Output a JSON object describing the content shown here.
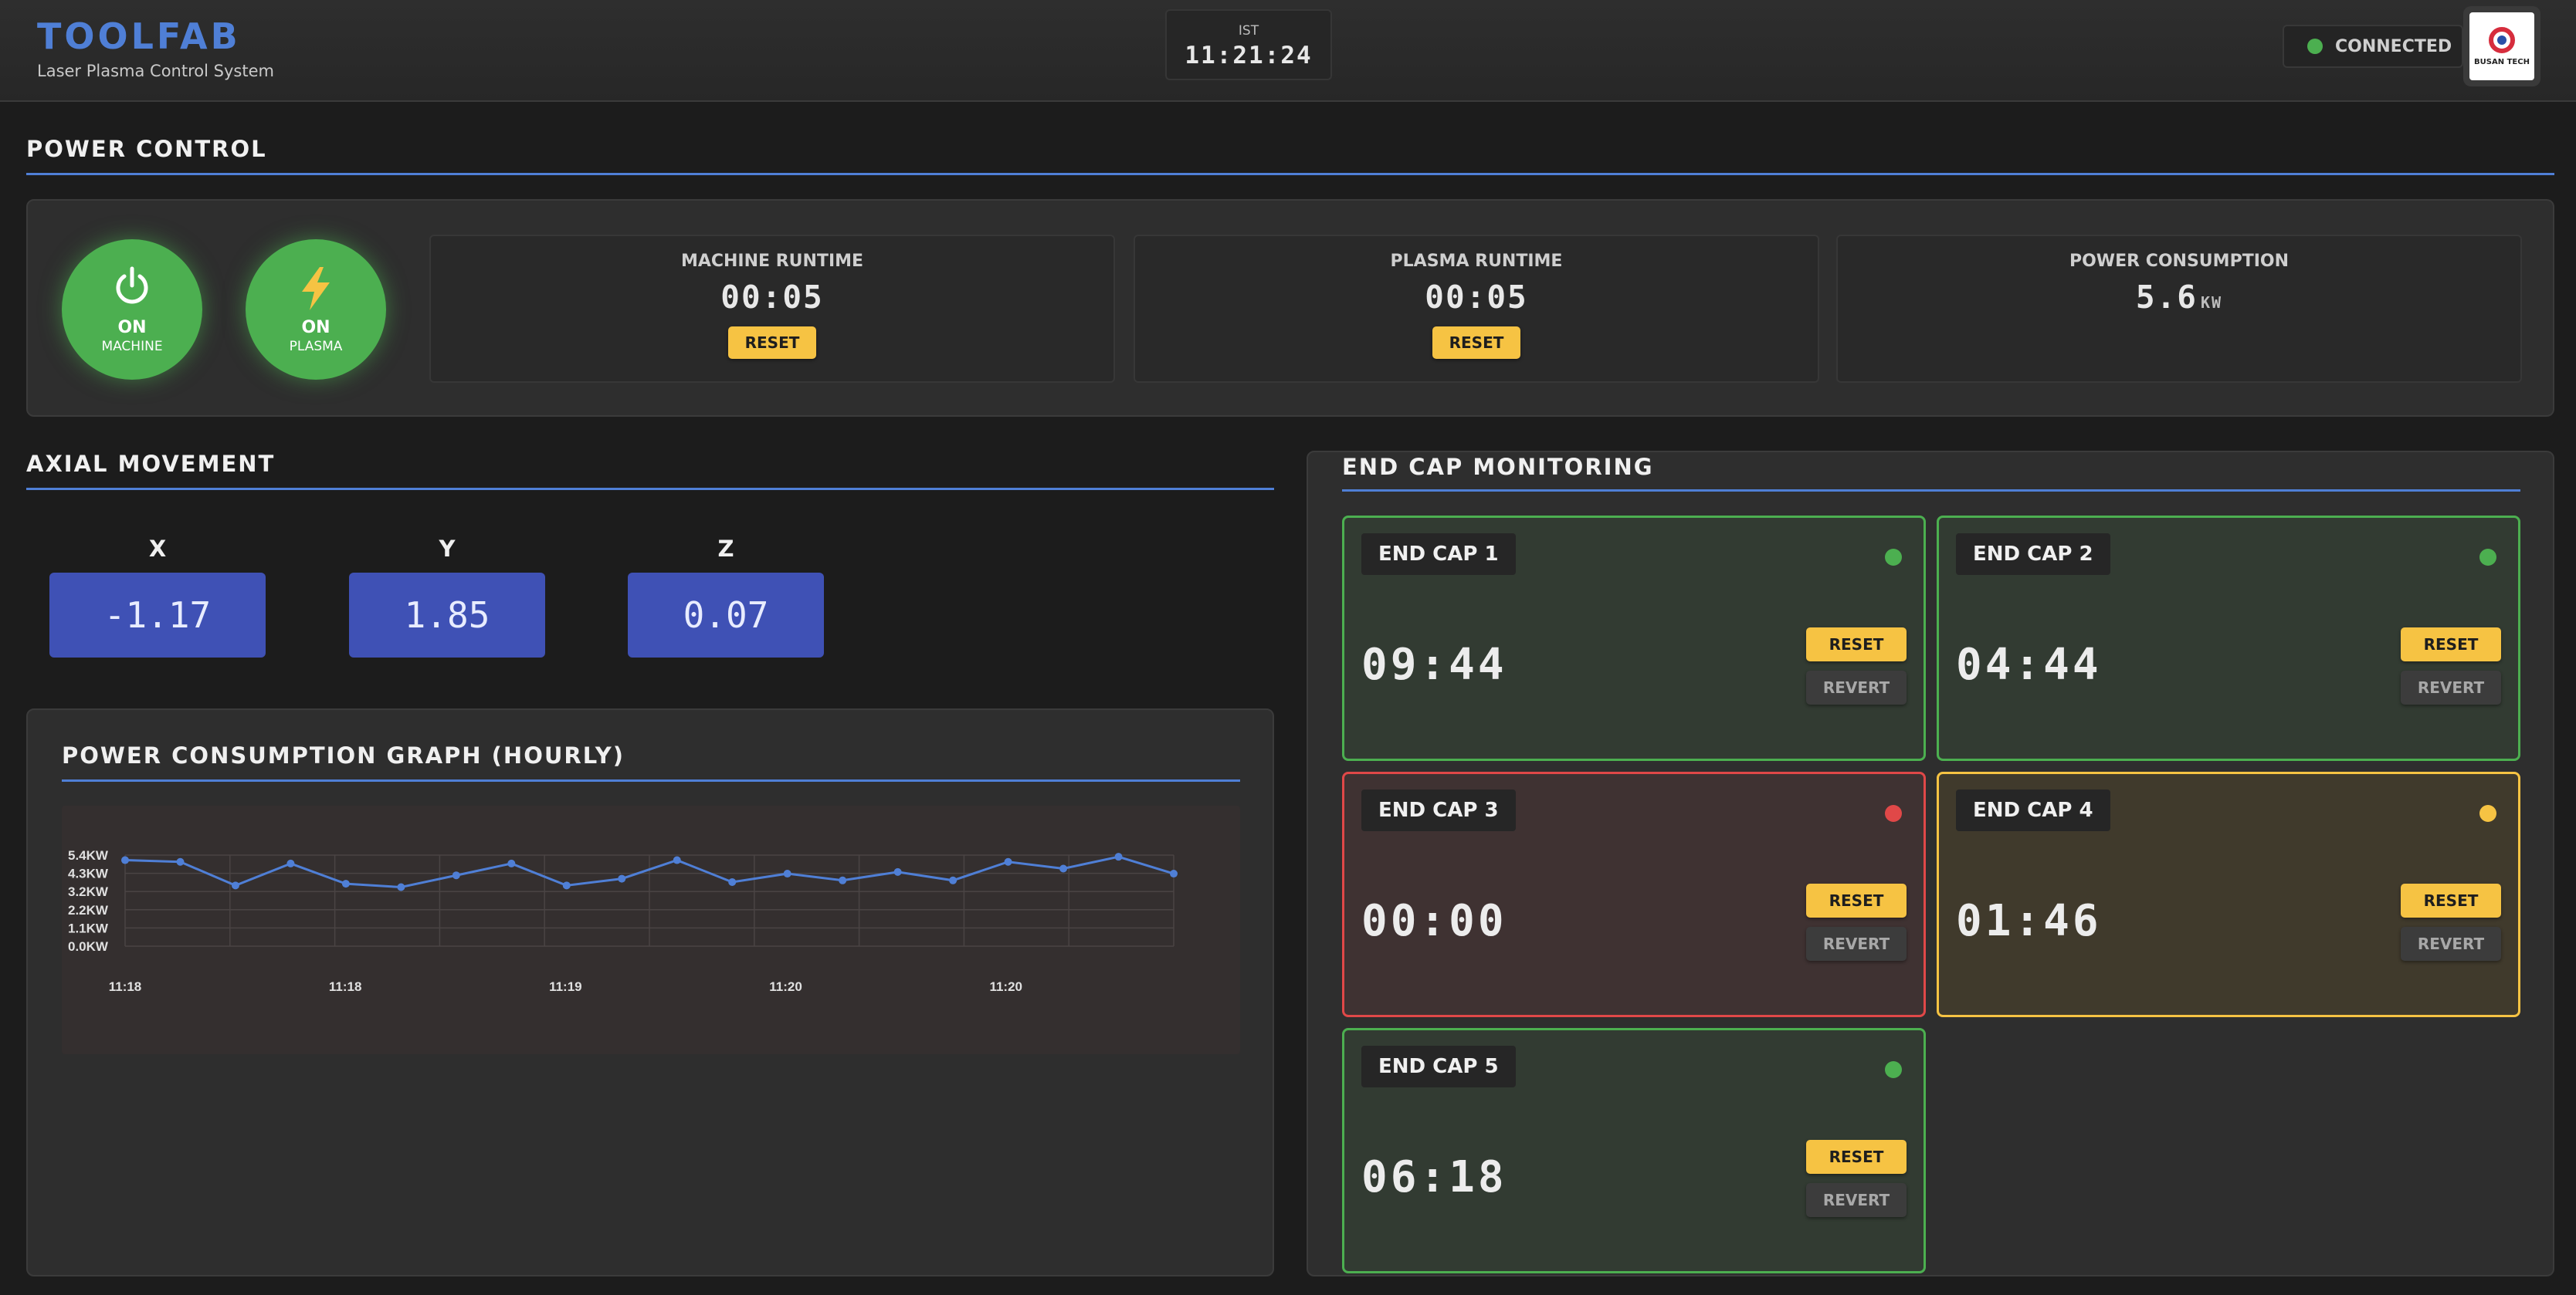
{
  "header": {
    "brand": "TOOLFAB",
    "subtitle": "Laser Plasma Control System",
    "timezone": "IST",
    "time": "11:21:24",
    "connection_status": "CONNECTED",
    "logo_text": "BUSAN TECH"
  },
  "power_control": {
    "title": "POWER CONTROL",
    "machine_button": {
      "state": "ON",
      "name": "MACHINE",
      "icon": "power-icon"
    },
    "plasma_button": {
      "state": "ON",
      "name": "PLASMA",
      "icon": "lightning-icon"
    },
    "machine_runtime": {
      "label": "MACHINE RUNTIME",
      "value": "00:05",
      "reset_label": "RESET"
    },
    "plasma_runtime": {
      "label": "PLASMA RUNTIME",
      "value": "00:05",
      "reset_label": "RESET"
    },
    "power_consumption": {
      "label": "POWER CONSUMPTION",
      "value": "5.6",
      "unit": "KW"
    }
  },
  "axial_movement": {
    "title": "AXIAL MOVEMENT",
    "axes": [
      {
        "label": "X",
        "value": "-1.17"
      },
      {
        "label": "Y",
        "value": "1.85"
      },
      {
        "label": "Z",
        "value": "0.07"
      }
    ]
  },
  "graph": {
    "title": "POWER CONSUMPTION GRAPH (HOURLY)"
  },
  "chart_data": {
    "type": "line",
    "title": "",
    "xlabel": "",
    "ylabel": "",
    "y_tick_labels": [
      "5.4KW",
      "4.3KW",
      "3.2KW",
      "2.2KW",
      "1.1KW",
      "0.0KW"
    ],
    "x_tick_labels": [
      "11:18",
      "11:18",
      "11:19",
      "11:20",
      "11:20"
    ],
    "ylim": [
      0,
      5.4
    ],
    "grid": true,
    "series": [
      {
        "values": [
          5.1,
          5.0,
          3.6,
          4.9,
          3.7,
          3.5,
          4.2,
          4.9,
          3.6,
          4.0,
          5.1,
          3.8,
          4.3,
          3.9,
          4.4,
          3.9,
          5.0,
          4.6,
          5.3,
          4.3
        ]
      }
    ],
    "line_color": "#4f7fd6"
  },
  "end_caps": {
    "title": "END CAP MONITORING",
    "reset_label": "RESET",
    "revert_label": "REVERT",
    "items": [
      {
        "name": "END CAP 1",
        "time": "09:44",
        "status": "green"
      },
      {
        "name": "END CAP 2",
        "time": "04:44",
        "status": "green"
      },
      {
        "name": "END CAP 3",
        "time": "00:00",
        "status": "red"
      },
      {
        "name": "END CAP 4",
        "time": "01:46",
        "status": "yellow"
      },
      {
        "name": "END CAP 5",
        "time": "06:18",
        "status": "green"
      }
    ]
  }
}
